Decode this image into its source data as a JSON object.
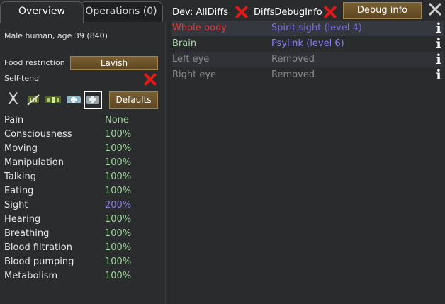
{
  "tabs": {
    "overview": "Overview",
    "operations": "Operations (0)"
  },
  "pawn": {
    "description": "Male human, age 39 (840)"
  },
  "food": {
    "label": "Food restriction",
    "value": "Lavish"
  },
  "self_tend": {
    "label": "Self-tend"
  },
  "medical": {
    "defaults_label": "Defaults",
    "x_label": "X"
  },
  "capacities": [
    {
      "name": "Pain",
      "value": "None"
    },
    {
      "name": "Consciousness",
      "value": "100%"
    },
    {
      "name": "Moving",
      "value": "100%"
    },
    {
      "name": "Manipulation",
      "value": "100%"
    },
    {
      "name": "Talking",
      "value": "100%"
    },
    {
      "name": "Eating",
      "value": "100%"
    },
    {
      "name": "Sight",
      "value": "200%"
    },
    {
      "name": "Hearing",
      "value": "100%"
    },
    {
      "name": "Breathing",
      "value": "100%"
    },
    {
      "name": "Blood filtration",
      "value": "100%"
    },
    {
      "name": "Blood pumping",
      "value": "100%"
    },
    {
      "name": "Metabolism",
      "value": "100%"
    }
  ],
  "debug": {
    "alldiffs": "Dev: AllDiffs",
    "diffs_debug": "DiffsDebugInfo",
    "debug_info": "Debug info"
  },
  "hediffs": [
    {
      "part": "Whole body",
      "condition": "Spirit sight (level 4)",
      "part_color": "#e03a3a",
      "cond_color": "#7b6ee0"
    },
    {
      "part": "Brain",
      "condition": "Psylink (level 6)",
      "part_color": "#a9d6a9",
      "cond_color": "#8a80ef"
    },
    {
      "part": "Left eye",
      "condition": "Removed",
      "part_color": "#8a8a8a",
      "cond_color": "#8a8a8a"
    },
    {
      "part": "Right eye",
      "condition": "Removed",
      "part_color": "#8a8a8a",
      "cond_color": "#8a8a8a"
    }
  ],
  "colors": {
    "accent_red": "#e01919",
    "wood": "#6b5128",
    "good": "#9fd39f",
    "enhanced": "#8a7de6"
  }
}
